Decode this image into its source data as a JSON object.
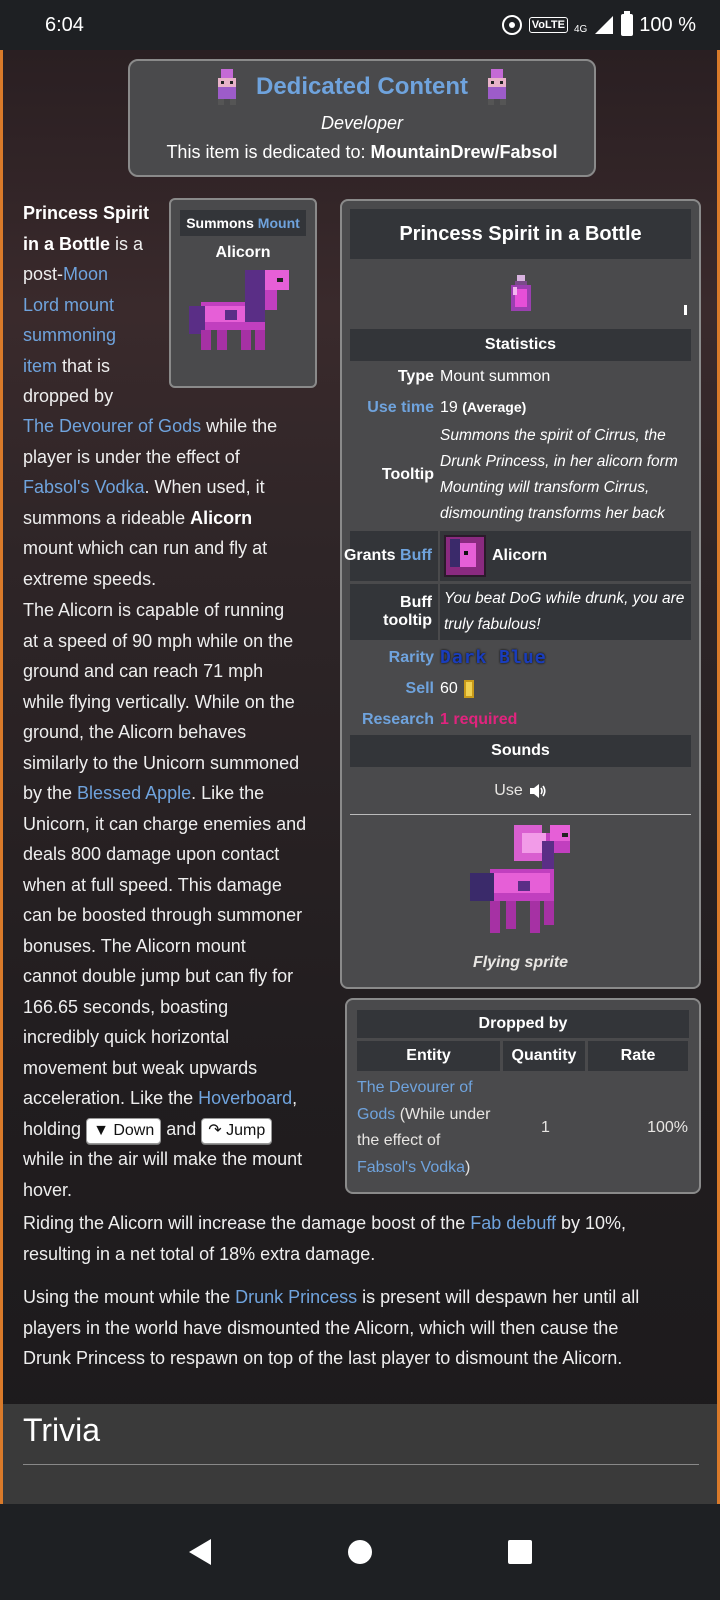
{
  "status": {
    "time": "6:04",
    "volte": "VoLTE",
    "network": "4G",
    "battery": "100 %"
  },
  "dedicated": {
    "title": "Dedicated Content",
    "role": "Developer",
    "text_prefix": "This item is dedicated to: ",
    "text_name": "MountainDrew/Fabsol"
  },
  "intro": {
    "l1": "Princess Spirit",
    "l2a": "in a Bottle",
    "l2b": " is a",
    "l3a": "post-",
    "l3b": "Moon",
    "l4": "Lord mount",
    "l5": "summoning",
    "l6a": "item",
    "l6b": " that is",
    "l7": "dropped by",
    "l8a": "The Devourer of Gods",
    "l8b": " while the",
    "l9": "player is under the effect of",
    "l10a": "Fabsol's Vodka",
    "l10b": ". When used, it",
    "l11a": "summons a rideable ",
    "l11b": "Alicorn",
    "l12": "mount which can run and fly at",
    "l13": "extreme speeds."
  },
  "summons": {
    "label": "Summons",
    "link": "Mount",
    "name": "Alicorn"
  },
  "infobox": {
    "title": "Princess Spirit in a Bottle",
    "statistics": "Statistics",
    "type_key": "Type",
    "type_val": "Mount summon",
    "usetime_key": "Use time",
    "usetime_val": "19",
    "usetime_note": "(Average)",
    "tooltip_key": "Tooltip",
    "tooltip_l1": "Summons the spirit of Cirrus, the",
    "tooltip_l2": "Drunk Princess, in her alicorn form",
    "tooltip_l3": "Mounting will transform Cirrus,",
    "tooltip_l4": "dismounting transforms her back",
    "grants_key": "Grants",
    "grants_link": "Buff",
    "grants_val": "Alicorn",
    "bufftip_key": "Buff tooltip",
    "bufftip_l1": "You beat DoG while drunk, you are",
    "bufftip_l2": "truly fabulous!",
    "rarity_key": "Rarity",
    "rarity_val": "Dark Blue",
    "sell_key": "Sell",
    "sell_val": "60",
    "research_key": "Research",
    "research_val": "1 required",
    "sounds": "Sounds",
    "use_label": "Use",
    "sprite_caption": "Flying sprite"
  },
  "dropped": {
    "title": "Dropped by",
    "col_entity": "Entity",
    "col_quantity": "Quantity",
    "col_rate": "Rate",
    "entity_l1": "The Devourer of",
    "entity_l2a": "Gods",
    "entity_l2b": " (While under",
    "entity_l3": "the effect of",
    "entity_l4a": "Fabsol's Vodka",
    "entity_l4b": ")",
    "quantity": "1",
    "rate": "100%"
  },
  "para2": {
    "l1": "The Alicorn is capable of running",
    "l2": "at a speed of 90 mph while on the",
    "l3": "ground and can reach 71 mph",
    "l4": "while flying vertically. While on the",
    "l5": "ground, the Alicorn behaves",
    "l6": "similarly to the Unicorn summoned",
    "l7a": "by the ",
    "l7b": "Blessed Apple",
    "l7c": ". Like the",
    "l8": "Unicorn, it can charge enemies and",
    "l9": "deals 800 damage upon contact",
    "l10": "when at full speed. This damage",
    "l11": "can be boosted through summoner",
    "l12": "bonuses. The Alicorn mount",
    "l13": "cannot double jump but can fly for",
    "l14": "166.65 seconds, boasting",
    "l15": "incredibly quick horizontal",
    "l16": "movement but weak upwards",
    "l17a": "acceleration. Like the ",
    "l17b": "Hoverboard",
    "l17c": ",",
    "l18a": "holding ",
    "key_down": "▼ Down",
    "l18b": " and ",
    "key_jump": "↷ Jump",
    "l19": "while in the air will make the mount",
    "l20": "hover."
  },
  "para3": {
    "l1a": "Riding the Alicorn will increase the damage boost of the ",
    "l1b": "Fab debuff",
    "l1c": " by 10%,",
    "l2": "resulting in a net total of 18% extra damage."
  },
  "para4": {
    "l1a": "Using the mount while the ",
    "l1b": "Drunk Princess",
    "l1c": " is present will despawn her until all",
    "l2": "players in the world have dismounted the Alicorn, which will then cause the",
    "l3": "Drunk Princess to respawn on top of the last player to dismount the Alicorn."
  },
  "trivia": "Trivia",
  "colors": {
    "link": "#6fa3dd",
    "accent_border": "#d97a2a",
    "research": "#e0247e",
    "rarity": "#1a3dbb"
  },
  "icons": [
    "wifi-hotspot-icon",
    "signal-icon",
    "battery-icon",
    "speaker-icon",
    "coin-icon",
    "back-icon",
    "home-icon",
    "recents-icon"
  ]
}
